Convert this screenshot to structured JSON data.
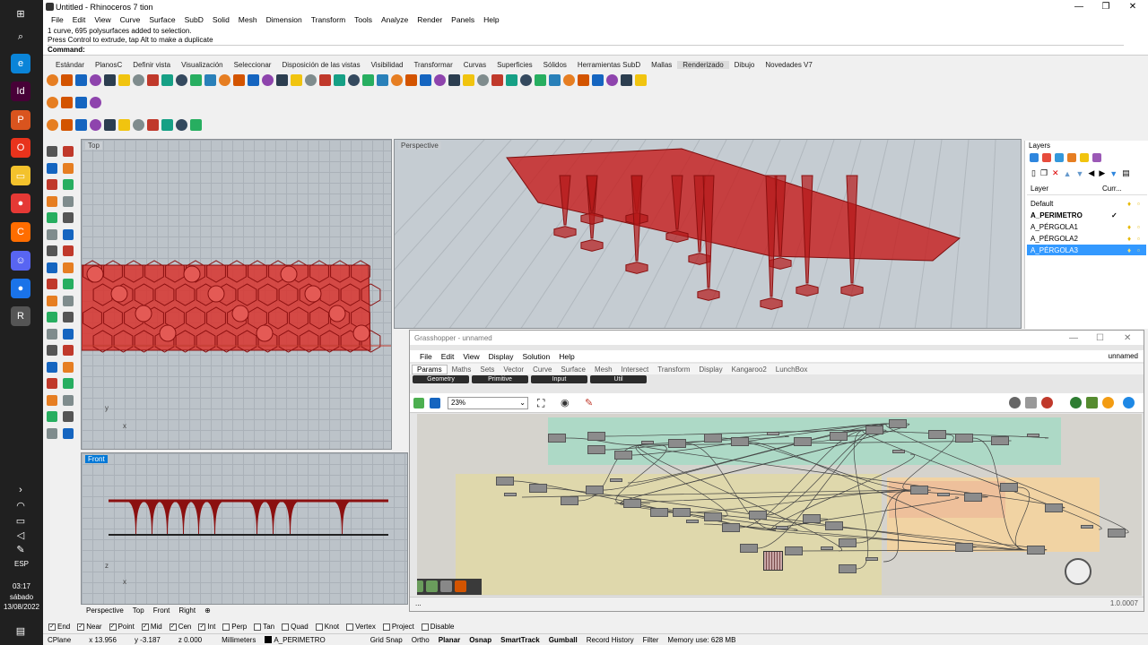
{
  "taskbar": {
    "lang": "ESP",
    "time": "03:17",
    "day": "sábado",
    "date": "13/08/2022"
  },
  "rhino": {
    "title": "Untitled - Rhinoceros 7 tion",
    "menu": [
      "File",
      "Edit",
      "View",
      "Curve",
      "Surface",
      "SubD",
      "Solid",
      "Mesh",
      "Dimension",
      "Transform",
      "Tools",
      "Analyze",
      "Render",
      "Panels",
      "Help"
    ],
    "history": [
      "1 curve, 695 polysurfaces added to selection.",
      "Press Control to extrude, tap Alt to make a duplicate"
    ],
    "command_label": "Command:",
    "tabs": [
      "Estándar",
      "PlanosC",
      "Definir vista",
      "Visualización",
      "Seleccionar",
      "Disposición de las vistas",
      "Visibilidad",
      "Transformar",
      "Curvas",
      "Superficies",
      "Sólidos",
      "Herramientas SubD",
      "Mallas",
      "Renderizado",
      "Dibujo",
      "Novedades V7"
    ],
    "viewports": {
      "top": "Top",
      "perspective": "Perspective",
      "front": "Front"
    },
    "viewport_tabs": [
      "Perspective",
      "Top",
      "Front",
      "Right"
    ],
    "layers": {
      "title": "Layers",
      "col_layer": "Layer",
      "col_current": "Curr...",
      "items": [
        {
          "name": "Default"
        },
        {
          "name": "A_PERIMETRO",
          "current": true
        },
        {
          "name": "A_PÉRGOLA1"
        },
        {
          "name": "A_PÉRGOLA2"
        },
        {
          "name": "A_PÉRGOLA3",
          "selected": true
        }
      ]
    },
    "osnap": [
      "End",
      "Near",
      "Point",
      "Mid",
      "Cen",
      "Int",
      "Perp",
      "Tan",
      "Quad",
      "Knot",
      "Vertex",
      "Project",
      "Disable"
    ],
    "osnap_checked": [
      true,
      true,
      true,
      true,
      true,
      true,
      false,
      false,
      false,
      false,
      false,
      false,
      false
    ],
    "status": {
      "cplane": "CPlane",
      "x": "x 13.956",
      "y": "y -3.187",
      "z": "z 0.000",
      "units": "Millimeters",
      "layer": "A_PERIMETRO",
      "toggles": [
        "Grid Snap",
        "Ortho",
        "Planar",
        "Osnap",
        "SmartTrack",
        "Gumball",
        "Record History",
        "Filter"
      ],
      "bold_toggles": [
        "Planar",
        "Osnap",
        "SmartTrack",
        "Gumball"
      ],
      "memory": "Memory use: 628 MB"
    }
  },
  "grasshopper": {
    "title": "Grasshopper - unnamed",
    "doc_name": "unnamed",
    "menu": [
      "File",
      "Edit",
      "View",
      "Display",
      "Solution",
      "Help"
    ],
    "tabs": [
      "Params",
      "Maths",
      "Sets",
      "Vector",
      "Curve",
      "Surface",
      "Mesh",
      "Intersect",
      "Transform",
      "Display",
      "Kangaroo2",
      "LunchBox"
    ],
    "subtabs": [
      "Geometry",
      "Primitive",
      "Input",
      "Util"
    ],
    "zoom": "23%",
    "version": "1.0.0007",
    "status_left": "..."
  },
  "colors": {
    "accent": "#0078d7",
    "geometry": "#cc1f1f",
    "viewport": "#bcc3c9",
    "group_green": "#a9d9c5",
    "group_yellow": "#e0d8a8",
    "group_orange": "#f2d3a0"
  }
}
